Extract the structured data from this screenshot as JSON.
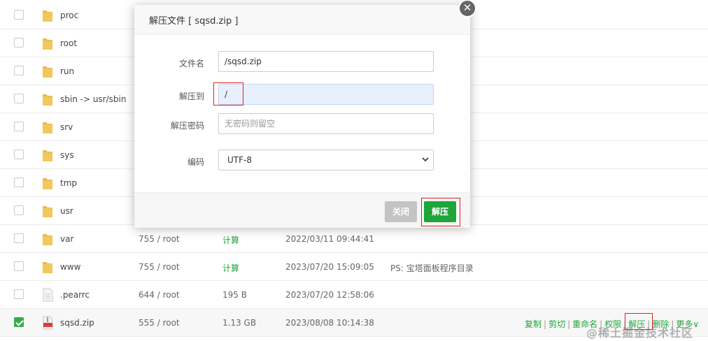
{
  "files": [
    {
      "name": "proc",
      "type": "folder"
    },
    {
      "name": "root",
      "type": "folder"
    },
    {
      "name": "run",
      "type": "folder"
    },
    {
      "name": "sbin -> usr/sbin",
      "type": "folder"
    },
    {
      "name": "srv",
      "type": "folder"
    },
    {
      "name": "sys",
      "type": "folder"
    },
    {
      "name": "tmp",
      "type": "folder"
    },
    {
      "name": "usr",
      "type": "folder"
    },
    {
      "name": "var",
      "type": "folder",
      "perm": "755 / root",
      "size": "计算",
      "time": "2022/03/11 09:44:41",
      "note": ""
    },
    {
      "name": "www",
      "type": "folder",
      "perm": "755 / root",
      "size": "计算",
      "time": "2023/07/20 15:09:05",
      "note": "PS: 宝塔面板程序目录"
    },
    {
      "name": ".pearrc",
      "type": "file",
      "perm": "644 / root",
      "size": "195 B",
      "time": "2023/07/20 12:58:06",
      "note": ""
    },
    {
      "name": "sqsd.zip",
      "type": "zip",
      "perm": "555 / root",
      "size": "1.13 GB",
      "time": "2023/08/08 10:14:38",
      "note": "",
      "checked": true
    }
  ],
  "row_actions": [
    "复制",
    "剪切",
    "重命名",
    "权限",
    "解压",
    "删除",
    "更多"
  ],
  "dialog": {
    "title": "解压文件 [ sqsd.zip ]",
    "close_icon": "✕",
    "filename_label": "文件名",
    "filename_value": "/sqsd.zip",
    "dest_label": "解压到",
    "dest_value": "/",
    "password_label": "解压密码",
    "password_placeholder": "无密码则留空",
    "encoding_label": "编码",
    "encoding_value": "UTF-8",
    "close_button": "关闭",
    "extract_button": "解压"
  },
  "watermark": "@稀土掘金技术社区",
  "colors": {
    "accent": "#20a53a",
    "folder": "#e9b949",
    "highlight": "#e02020"
  }
}
